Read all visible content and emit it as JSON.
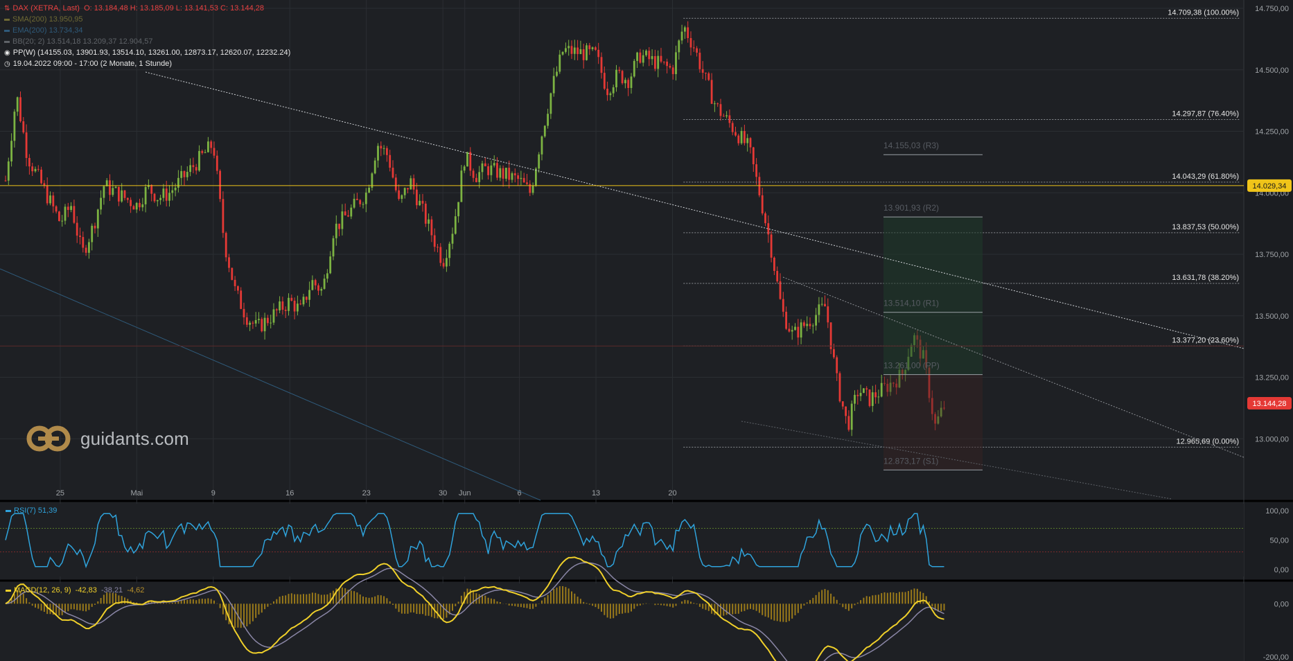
{
  "header": {
    "instrument": "DAX (XETRA, Last)",
    "ohlc": "O: 13.184,48  H: 13.185,09  L: 13.141,53  C: 13.144,28",
    "sma": "SMA(200)  13.950,95",
    "ema": "EMA(200)  13.734,34",
    "bb": "BB(20; 2)  13.514,18  13.209,37  12.904,57",
    "pp": "PP(W)  (14155.03, 13901.93, 13514.10, 13261.00, 12873.17, 12620.07, 12232.24)",
    "session": "19.04.2022 09:00 - 17:00   (2 Monate, 1 Stunde)"
  },
  "logo": {
    "text": "guidants.com"
  },
  "colors": {
    "background": "#1e2024",
    "up": "#7cb342",
    "down": "#e53935",
    "price_line": "#f0c419",
    "last_badge": "#e53935",
    "rsi": "#2fa3dc",
    "macd": "#f0d02a",
    "signal": "#8a86a6"
  },
  "chart_data": {
    "type": "candlestick",
    "title": "DAX (XETRA, Last)",
    "ylim": [
      12750,
      14750
    ],
    "y_ticks": [
      {
        "value": 14750,
        "label": "14.750,00"
      },
      {
        "value": 14500,
        "label": "14.500,00"
      },
      {
        "value": 14250,
        "label": "14.250,00"
      },
      {
        "value": 14000,
        "label": "14.000,00"
      },
      {
        "value": 13750,
        "label": "13.750,00"
      },
      {
        "value": 13500,
        "label": "13.500,00"
      },
      {
        "value": 13250,
        "label": "13.250,00"
      },
      {
        "value": 13000,
        "label": "13.000,00"
      }
    ],
    "x_ticks": [
      "25",
      "Mai",
      "9",
      "16",
      "23",
      "30",
      "Jun",
      "6",
      "13",
      "20"
    ],
    "price_path": [
      [
        "2022-04-20",
        14050
      ],
      [
        "2022-04-21",
        14400
      ],
      [
        "2022-04-22",
        14150
      ],
      [
        "2022-04-25",
        13880
      ],
      [
        "2022-04-26",
        13950
      ],
      [
        "2022-04-27",
        13750
      ],
      [
        "2022-04-28",
        13860
      ],
      [
        "2022-04-29",
        14030
      ],
      [
        "2022-05-02",
        13950
      ],
      [
        "2022-05-03",
        14020
      ],
      [
        "2022-05-04",
        13980
      ],
      [
        "2022-05-05",
        14000
      ],
      [
        "2022-05-06",
        14050
      ],
      [
        "2022-05-09",
        14200
      ],
      [
        "2022-05-10",
        13800
      ],
      [
        "2022-05-11",
        13600
      ],
      [
        "2022-05-12",
        13500
      ],
      [
        "2022-05-13",
        13450
      ],
      [
        "2022-05-16",
        13560
      ],
      [
        "2022-05-17",
        13520
      ],
      [
        "2022-05-18",
        13640
      ],
      [
        "2022-05-19",
        13600
      ],
      [
        "2022-05-20",
        13850
      ],
      [
        "2022-05-23",
        14000
      ],
      [
        "2022-05-24",
        14200
      ],
      [
        "2022-05-25",
        14150
      ],
      [
        "2022-05-26",
        13950
      ],
      [
        "2022-05-27",
        14050
      ],
      [
        "2022-05-30",
        13720
      ],
      [
        "2022-05-31",
        13870
      ],
      [
        "2022-06-01",
        14150
      ],
      [
        "2022-06-02",
        14070
      ],
      [
        "2022-06-03",
        14100
      ],
      [
        "2022-06-06",
        14050
      ],
      [
        "2022-06-07",
        14000
      ],
      [
        "2022-06-08",
        14230
      ],
      [
        "2022-06-09",
        14430
      ],
      [
        "2022-06-10",
        14580
      ],
      [
        "2022-06-13",
        14560
      ],
      [
        "2022-06-14",
        14420
      ],
      [
        "2022-06-15",
        14480
      ],
      [
        "2022-06-16",
        14460
      ],
      [
        "2022-06-17",
        14560
      ],
      [
        "2022-06-20",
        14500
      ],
      [
        "2022-06-21",
        14680
      ],
      [
        "2022-06-22",
        14590
      ],
      [
        "2022-06-23",
        14460
      ],
      [
        "2022-06-24",
        14350
      ],
      [
        "2022-06-27",
        14180
      ],
      [
        "2022-06-28",
        13990
      ],
      [
        "2022-06-29",
        13780
      ],
      [
        "2022-06-30",
        13520
      ],
      [
        "2022-07-01",
        13420
      ],
      [
        "2022-07-04",
        13540
      ],
      [
        "2022-07-05",
        13240
      ],
      [
        "2022-07-06",
        13050
      ],
      [
        "2022-07-07",
        13200
      ],
      [
        "2022-07-08",
        13160
      ],
      [
        "2022-07-11",
        13260
      ],
      [
        "2022-07-12",
        13420
      ],
      [
        "2022-07-13",
        13320
      ],
      [
        "2022-07-14",
        13050
      ],
      [
        "2022-07-15",
        13150
      ]
    ],
    "horizontal_levels": [
      {
        "value": 14709.38,
        "label": "14.709,38 (100.00%)"
      },
      {
        "value": 14297.87,
        "label": "14.297,87 (76.40%)"
      },
      {
        "value": 14043.29,
        "label": "14.043,29 (61.80%)"
      },
      {
        "value": 13837.53,
        "label": "13.837,53 (50.00%)"
      },
      {
        "value": 13631.78,
        "label": "13.631,78 (38.20%)"
      },
      {
        "value": 13377.2,
        "label": "13.377,20 (23.60%)"
      },
      {
        "value": 12965.69,
        "label": "12.965,69 (0.00%)"
      }
    ],
    "pivot_levels": [
      {
        "value": 14155.03,
        "label": "14.155,03 (R3)"
      },
      {
        "value": 13901.93,
        "label": "13.901,93 (R2)"
      },
      {
        "value": 13514.1,
        "label": "13.514,10 (R1)"
      },
      {
        "value": 13261.0,
        "label": "13.261,00 (PP)"
      },
      {
        "value": 12873.17,
        "label": "12.873,17 (S1)"
      }
    ],
    "price_badges": [
      {
        "value": 14029.34,
        "label": "14.029,34"
      },
      {
        "value": 13144.28,
        "label": "13.144,28"
      }
    ],
    "rsi": {
      "label": "RSI(7)  51,39",
      "ylim": [
        0,
        100
      ],
      "ticks": [
        {
          "value": 100,
          "label": "100,00"
        },
        {
          "value": 50,
          "label": "50,00"
        },
        {
          "value": 0,
          "label": "0,00"
        }
      ],
      "bands": [
        70,
        30
      ]
    },
    "macd": {
      "label": "MACD(12, 26, 9)",
      "value": "-42,83",
      "signal": "-38,21",
      "hist": "-4,62",
      "ticks": [
        {
          "value": 0,
          "label": "0,00"
        },
        {
          "value": -200,
          "label": "-200,00"
        }
      ]
    }
  }
}
